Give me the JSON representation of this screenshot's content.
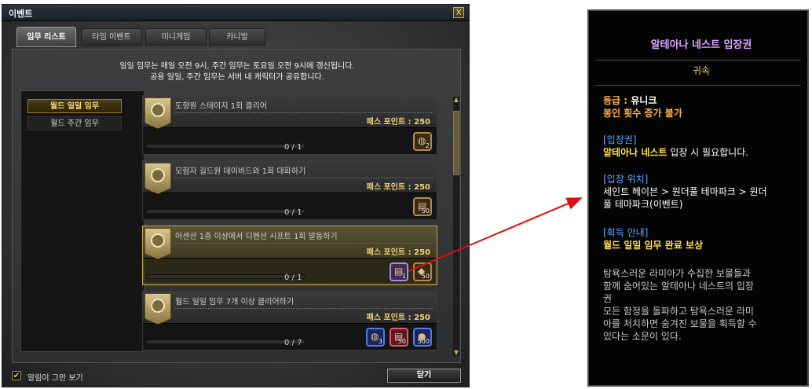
{
  "window": {
    "title": "이벤트",
    "close_glyph": "X"
  },
  "tabs": [
    {
      "label": "임무 리스트",
      "active": true
    },
    {
      "label": "타임 이벤트",
      "active": false
    },
    {
      "label": "미니게임",
      "active": false
    },
    {
      "label": "카니발",
      "active": false
    }
  ],
  "notice": [
    "일일 임무는 매일 오전 9시, 주간 임무는 토요일 오전 9시에 갱신됩니다.",
    "공용 일일, 주간 임무는 서버 내 캐릭터가 공유합니다."
  ],
  "categories": [
    {
      "label": "월드 일일 임무",
      "active": true
    },
    {
      "label": "월드 주간 임무",
      "active": false
    }
  ],
  "quests": [
    {
      "name": "도향원 스테이지 1회 클리어",
      "points": "패스 포인트 : 250",
      "progress": "0 / 1",
      "progress_fraction": 0,
      "rewards": [
        {
          "count": "2",
          "color": "orange",
          "icon": "pouch-icon"
        }
      ]
    },
    {
      "name": "모험자 길드원 데이비드와 1회 대화하기",
      "points": "패스 포인트 : 250",
      "progress": "0 / 1",
      "progress_fraction": 0,
      "rewards": [
        {
          "count": "50",
          "color": "orange",
          "icon": "ticket-icon"
        }
      ]
    },
    {
      "name": "어센션 1층 이상에서 디멘션 시프트 1회 발동하기",
      "points": "패스 포인트 : 250",
      "progress": "0 / 1",
      "progress_fraction": 0,
      "selected": true,
      "rewards": [
        {
          "count": "1",
          "color": "purple",
          "icon": "ticket-icon"
        },
        {
          "count": "50",
          "color": "orange",
          "icon": "gem-icon"
        }
      ]
    },
    {
      "name": "월드 일일 임무 7개 이상 클리어하기",
      "points": "패스 포인트 : 250",
      "progress": "0 / 7",
      "progress_fraction": 0,
      "rewards": [
        {
          "count": "3",
          "color": "blue",
          "icon": "pouch-icon"
        },
        {
          "count": "50",
          "color": "red",
          "icon": "ticket-icon"
        },
        {
          "count": "500",
          "color": "blue",
          "icon": "gold-icon"
        }
      ]
    }
  ],
  "footer": {
    "checkbox_label": "알림이 그만 보기",
    "checked": true,
    "check_glyph": "✔",
    "close_button": "닫기"
  },
  "scroll": {
    "up": "▲",
    "down": "▼"
  },
  "tooltip": {
    "title": "알테아나 네스트 입장권",
    "binding": "귀속",
    "grade_label": "등급 : ",
    "grade_value": "유니크",
    "seal": "봉인 횟수 증가 불가",
    "entry_header": "[입장권]",
    "entry_name": "알테아나 네스트",
    "entry_text": " 입장 시 필요합니다.",
    "location_header": "[입장 위치]",
    "location_text_1": "세인트 헤이븐 > 원더풀 테마파크 > 원더",
    "location_text_2": "풀 테마파크(이벤트)",
    "acquire_header": "[획득 안내]",
    "acquire_text": "월드 일일 임무 완료 보상",
    "desc_lines": [
      "탐욕스러운 라미아가 수집한 보물들과",
      "함께 숨어있는 알테아나 네스트의 입장",
      "권",
      "모든 함정을 돌파하고 탐욕스러운 라미",
      "아를 처치하면 숨겨진 보물을 획득할 수",
      "있다는 소문이 있다."
    ]
  },
  "colors": {
    "arrow": "#e01010",
    "gold_accent": "#c5a55a",
    "tooltip_title": "#d9a6ff"
  }
}
